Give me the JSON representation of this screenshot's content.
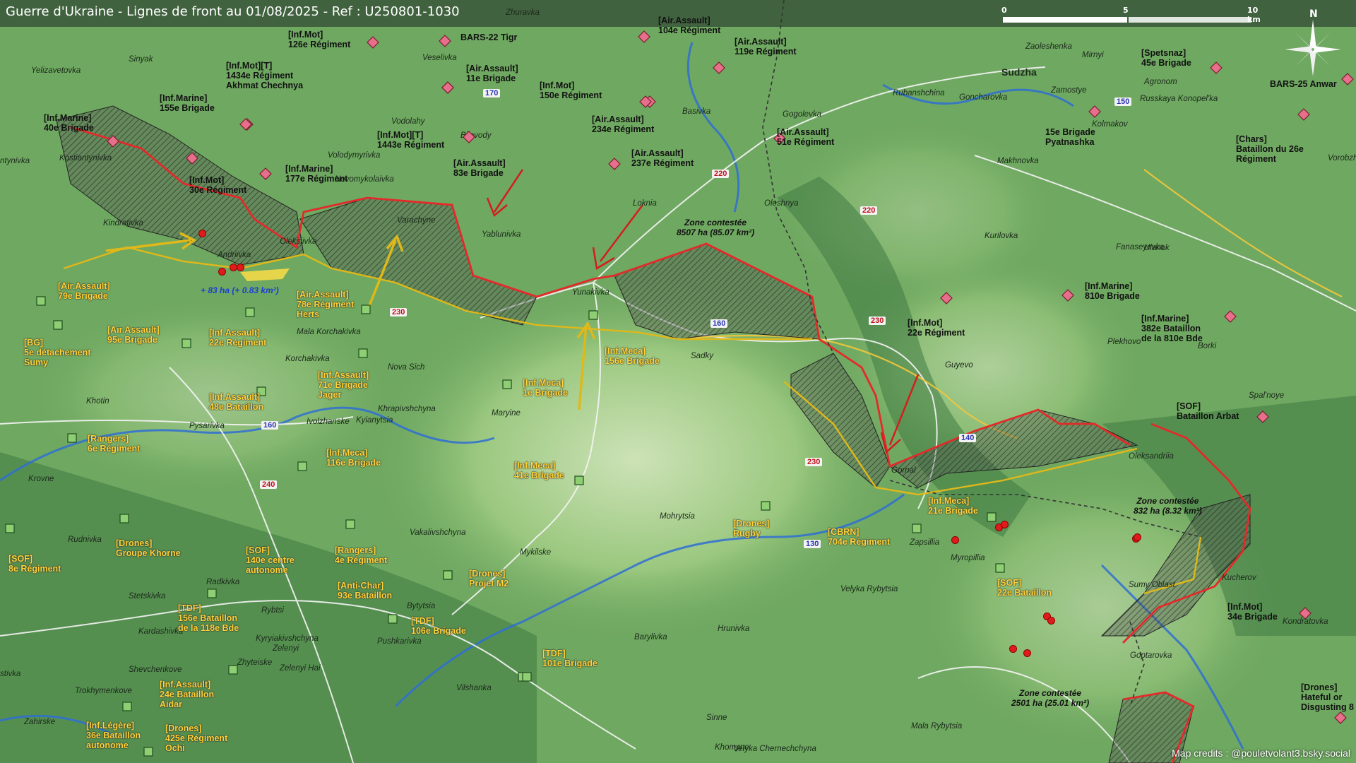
{
  "title": "Guerre d'Ukraine - Lignes de front au 01/08/2025 - Ref : U250801-1030",
  "scale_labels": [
    "0",
    "5",
    "10 km"
  ],
  "north_label": "N",
  "credits": "Map credits : @pouletvolant3.bsky.social",
  "colors": {
    "frontline": "#e32a2a",
    "ua_line": "#e0b81a",
    "ru_unit": "#e86f8c",
    "ua_unit": "#8fcf73",
    "terrain": "#6fa861",
    "water": "#2f6fd4"
  },
  "russian_units": [
    {
      "text": "[Inf.Mot]\n126e Régiment"
    },
    {
      "text": "BARS-22 Tigr"
    },
    {
      "text": "[Air.Assault]\n104e Régiment"
    },
    {
      "text": "[Air.Assault]\n119e Régiment"
    },
    {
      "text": "[Spetsnaz]\n45e Brigade"
    },
    {
      "text": "BARS-25 Anwar"
    },
    {
      "text": "[Inf.Mot][T]\n1434e Régiment\nAkhmat Chechnya"
    },
    {
      "text": "[Air.Assault]\n11e Brigade"
    },
    {
      "text": "[Inf.Mot]\n150e Régiment"
    },
    {
      "text": "[Inf.Marine]\n155e Brigade"
    },
    {
      "text": "[Inf.Marine]\n40e Brigade"
    },
    {
      "text": "[Inf.Mot][T]\n1443e Régiment"
    },
    {
      "text": "[Air.Assault]\n234e Régiment"
    },
    {
      "text": "[Air.Assault]\n51e Régiment"
    },
    {
      "text": "15e Brigade\nPyatnashka"
    },
    {
      "text": "[Chars]\nBataillon du 26e\nRégiment"
    },
    {
      "text": "[Air.Assault]\n237e Régiment"
    },
    {
      "text": "[Air.Assault]\n83e Brigade"
    },
    {
      "text": "[Inf.Marine]\n177e Régiment"
    },
    {
      "text": "[Inf.Mot]\n30e Régiment"
    },
    {
      "text": "[Inf.Marine]\n810e Brigade"
    },
    {
      "text": "[Inf.Marine]\n382e Bataillon\nde la 810e Bde"
    },
    {
      "text": "[Inf.Mot]\n22e Régiment"
    },
    {
      "text": "[SOF]\nBataillon Arbat"
    },
    {
      "text": "[Inf.Mot]\n34e Brigade"
    },
    {
      "text": "[Drones]\nHateful or\nDisgusting 8"
    }
  ],
  "ukrainian_units": [
    {
      "text": "[Air.Assault]\n79e Brigade"
    },
    {
      "text": "[Air.Assault]\n78e Régiment\nHerts"
    },
    {
      "text": "[Air.Assault]\n95e Brigade"
    },
    {
      "text": "[Inf.Assault]\n22e Régiment"
    },
    {
      "text": "[BG]\n5e détachement\nSumy"
    },
    {
      "text": "[Inf.Assault]\n71e Brigade\nJager"
    },
    {
      "text": "[Inf.Meca]\n156e Brigade"
    },
    {
      "text": "[Inf.Meca]\n1e Brigade"
    },
    {
      "text": "[Inf.Assault]\n48e Bataillon"
    },
    {
      "text": "[Rangers]\n6e Régiment"
    },
    {
      "text": "[Inf.Meca]\n116e Brigade"
    },
    {
      "text": "[Inf.Meca]\n41e Brigade"
    },
    {
      "text": "[Inf.Meca]\n21e Brigade"
    },
    {
      "text": "[Drones]\nRugby"
    },
    {
      "text": "[CBRN]\n704e Régiment"
    },
    {
      "text": "[SOF]\n8e Régiment"
    },
    {
      "text": "[Drones]\nGroupe Khorne"
    },
    {
      "text": "[SOF]\n140e centre\nautonome"
    },
    {
      "text": "[Rangers]\n4e Régiment"
    },
    {
      "text": "[Drones]\nProjet M2"
    },
    {
      "text": "[SOF]\n22e Bataillon"
    },
    {
      "text": "[Anti-Char]\n93e Bataillon"
    },
    {
      "text": "[TDF]\n156e Bataillon\nde la 118e Bde"
    },
    {
      "text": "[TDF]\n106e Brigade"
    },
    {
      "text": "[TDF]\n101e Brigade"
    },
    {
      "text": "[Inf.Assault]\n24e Bataillon\nAidar"
    },
    {
      "text": "[Inf.Légère]\n36e Bataillon\nautonome"
    },
    {
      "text": "[Drones]\n425e Régiment\nOchi"
    }
  ],
  "places": [
    "Zhuravka",
    "Yelizavetovka",
    "Sinyak",
    "Veselivka",
    "Zaoleshenka",
    "Sudzha",
    "Mirnyi",
    "Agronom",
    "Russkaya Konopel'ka",
    "Kolmakov",
    "Zamostye",
    "Goncharovka",
    "Rubanshchina",
    "Gogolevka",
    "Basivka",
    "Volodymyrivka",
    "Vodolahy",
    "Bilovody",
    "Makhnovka",
    "Vorobzh",
    "Kostiantynivka",
    "Novomykolaivka",
    "Oleshnya",
    "Loknia",
    "Yablunivka",
    "Varachyne",
    "Kindratіvka",
    "Oleksiivka",
    "Andrіivka",
    "Kurilovka",
    "Fanaseyevka",
    "Ulanok",
    "Yunakivka",
    "Sadky",
    "Mala Korchakivka",
    "Korchakivka",
    "Nova Sich",
    "Plekhovo",
    "Borki",
    "Guyevo",
    "Khotin",
    "Khrapivshchyna",
    "Kyianytsia",
    "Ivolzhanske",
    "Pysarivka",
    "Maryine",
    "Spal'noye",
    "Oleksandriia",
    "Gornal",
    "Krovne",
    "Vakalivshchyna",
    "Mohrytsia",
    "Rudnivka",
    "Mykilske",
    "Zapsillia",
    "Myropillia",
    "Kucherov",
    "Sumy Oblast",
    "Radkivka",
    "Stetskivka",
    "Bytytsia",
    "Rybtsi",
    "Kardashivka",
    "Kyryiakivshchyna",
    "Zelenyi",
    "Zhyteiske",
    "Zelenyi Hai",
    "Pushkarivka",
    "Velyka Rybytsia",
    "Hrunivka",
    "Barylivka",
    "Kondratovka",
    "Shevchenkove",
    "Goptarovka",
    "Trokhymenkove",
    "Vilshanka",
    "Zahirske",
    "Sinne",
    "Khomyne",
    "Mala Rybytsia",
    "Velyka Chernechchyna",
    "stivka",
    "ntynivka"
  ],
  "roads": [
    "170",
    "150",
    "220",
    "220",
    "230",
    "230",
    "230",
    "160",
    "160",
    "140",
    "240",
    "130"
  ],
  "zones": [
    {
      "text": "Zone contestée\n8507 ha (85.07 km²)"
    },
    {
      "text": "Zone contestée\n832 ha (8.32 km²)"
    },
    {
      "text": "Zone contestée\n2501 ha (25.01 km²)"
    }
  ],
  "gain_label": "+ 83 ha (+ 0.83 km²)"
}
